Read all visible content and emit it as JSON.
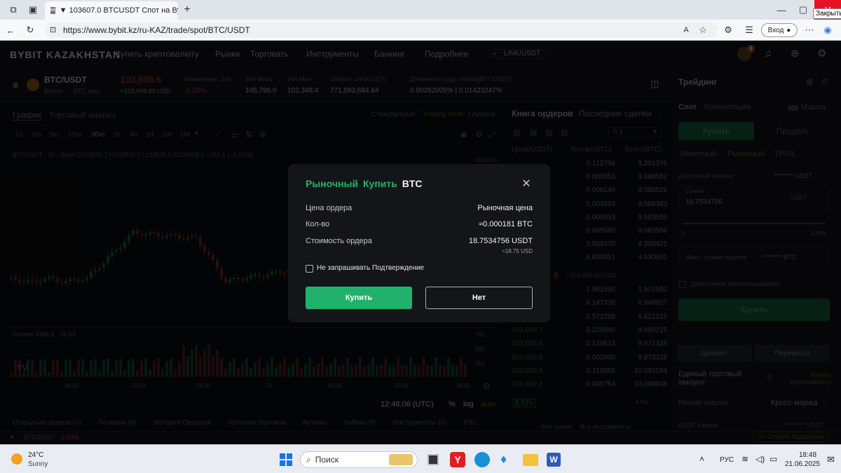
{
  "browser": {
    "tab_title": "▼ 103607.0 BTCUSDT Спот на Byb",
    "url": "https://www.bybit.kz/ru-KAZ/trade/spot/BTC/USDT",
    "login_label": "Вход",
    "close_tooltip": "Закрыть"
  },
  "site": {
    "logo": "BYBIT KAZAKHSTAN",
    "nav": [
      "Купить криптовалюту",
      "Рынки",
      "Торговать",
      "Инструменты",
      "Банкинг",
      "Подробнее"
    ],
    "search_placeholder": "LINK/USDT",
    "notifications_badge": "4"
  },
  "ticker": {
    "pair": "BTC/USDT",
    "sub_a": "Bitcoin",
    "sub_b": "BTC сеть",
    "price": "103,608.6",
    "price_usd": "≈103,608.60 USD",
    "change_label": "Изменение, 24ч",
    "change_value": "-2.00%",
    "high_label": "24ч Макс",
    "high_value": "105,796.0",
    "low_label": "24ч Мин",
    "low_value": "102,348.4",
    "volume_label": "Оборот, 24ч(USDT)",
    "volume_value": "771,592,684.64",
    "fee_label": "Денежная пред. ставка(BTCUSDT)",
    "fee_value": "0.00282005% | 0.01423247%"
  },
  "chart_panel": {
    "tabs": [
      "График",
      "Торговый анализ"
    ],
    "views": [
      "Стандартный",
      "Trading View",
      "Глубина"
    ],
    "intervals": [
      "1s",
      "1m",
      "5m",
      "15m",
      "30m",
      "1h",
      "4h",
      "1d",
      "1w",
      "1M"
    ],
    "ohlc": "BTCUSDT · 30 · Bybit  O103870.7 H103870.7 L103536.0 C103608.6 −156.1 (−0.15%)",
    "volume_label": "Volume SMA 9 · 78.53",
    "time_labels": [
      "06:00",
      "12:00",
      "18:00",
      "21",
      "06:00",
      "12:00",
      "18:00"
    ],
    "price_tick": "104000.0",
    "volume_ticks": [
      "750",
      "500",
      "250"
    ],
    "clock": "12:48:06 (UTC)",
    "scale_pct": "%",
    "scale_log": "log",
    "scale_auto": "auto"
  },
  "orderbook": {
    "tabs": [
      "Книга ордеров",
      "Последние сделки"
    ],
    "precision": "0.1",
    "headers": [
      "Цена(USDT)",
      "Кол-во(BTC)",
      "Всего(BTC)"
    ],
    "asks": [
      [
        "",
        "0.112794",
        "9.201376"
      ],
      [
        "",
        "0.000053",
        "9.088582"
      ],
      [
        "",
        "0.000146",
        "9.088529"
      ],
      [
        "",
        "0.004824",
        "9.088383"
      ],
      [
        "",
        "0.000053",
        "9.083559"
      ],
      [
        "",
        "0.685085",
        "9.083506"
      ],
      [
        "",
        "3.568370",
        "8.398421"
      ],
      [
        "",
        "4.830051",
        "4.830051"
      ]
    ],
    "mid_price": "6",
    "mid_usd": "≈103,608.60 USD",
    "bids": [
      [
        "",
        "1.901592",
        "1.901592"
      ],
      [
        "",
        "4.147335",
        "6.048927"
      ],
      [
        "",
        "0.572288",
        "6.621215"
      ],
      [
        "103,606.7",
        "3.229500",
        "9.850715"
      ],
      [
        "103,606.6",
        "0.120613",
        "9.971328"
      ],
      [
        "103,605.8",
        "0.002000",
        "9.973328"
      ],
      [
        "103,603.5",
        "0.118856",
        "10.092184"
      ],
      [
        "103,602.1",
        "0.006754",
        "10.098938"
      ]
    ],
    "ratio_buy": "B 53%",
    "ratio_sell": "47%"
  },
  "trade": {
    "title": "Трейдинг",
    "mode_spot": "Спот",
    "mode_convert": "Конвертация",
    "margin_label": "Маржа",
    "buy_tab": "Купить",
    "sell_tab": "Продать",
    "order_types": [
      "Лимитный",
      "Рыночный",
      "TP/SL"
    ],
    "available_label": "Доступный баланс",
    "available_value": "******** USDT",
    "amount_label": "Сумма",
    "amount_value": "18.7534756",
    "amount_unit": "USDT",
    "slider_min": "0",
    "slider_max": "100%",
    "max_buy_label": "Макс. сумма покупки",
    "max_buy_value": "******** BTC",
    "slippage_label": "Допустимое проскальзывание",
    "buy_button": "Купить",
    "deposit_button": "Депозит",
    "transfer_button": "Перевести",
    "unified_title": "Единый торговый аккаунт",
    "buy_crypto_link": "Купить криптовалюту",
    "margin_mode_label": "Режим маржи",
    "margin_mode_value": "Кросс-маржа",
    "usdt_balance_label": "USDT Баланс",
    "usdt_balance_value": "******** USDT"
  },
  "bottom_tabs": [
    "Открытые ордера (0)",
    "Позиции (0)",
    "История Ордеров",
    "История торговли",
    "Активы",
    "Займы (0)",
    "Инструменты (0)",
    "P&L"
  ],
  "bottom_right": [
    "Все рынки",
    "Все инструменты"
  ],
  "status": {
    "pair": "BTC/USDT",
    "change": "-2.00%",
    "support": "Служба поддержки"
  },
  "modal": {
    "title_order_type": "Рыночный",
    "title_side": "Купить",
    "title_asset": "BTC",
    "rows": [
      {
        "label": "Цена ордера",
        "value": "Рыночная цена"
      },
      {
        "label": "Кол-во",
        "value": "≈0.000181 BTC"
      },
      {
        "label": "Стоимость ордера",
        "value": "18.7534756 USDT"
      }
    ],
    "cost_usd": "≈18.75 USD",
    "checkbox_label": "Не запрашивать Подтверждение",
    "confirm_button": "Купить",
    "cancel_button": "Нет",
    "colors": {
      "accent": "#20b26c",
      "bg": "#141519"
    }
  },
  "taskbar": {
    "weather_temp": "24°C",
    "weather_desc": "Sunny",
    "search_placeholder": "Поиск",
    "lang": "РУС",
    "time": "18:48",
    "date": "21.06.2025"
  }
}
